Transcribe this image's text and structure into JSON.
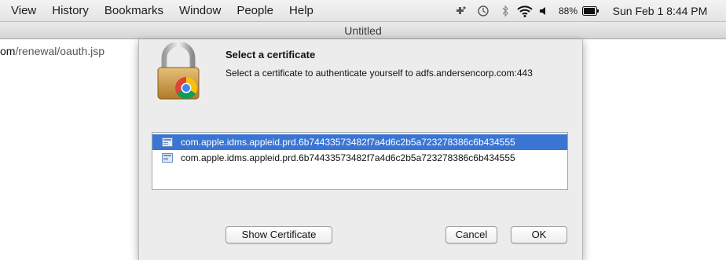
{
  "menubar": {
    "items": [
      "View",
      "History",
      "Bookmarks",
      "Window",
      "People",
      "Help"
    ],
    "battery_percent": "88%",
    "clock": "Sun Feb 1  8:44 PM"
  },
  "window": {
    "title": "Untitled"
  },
  "address": {
    "domain_tail": "om",
    "path": "/renewal/oauth.jsp"
  },
  "dialog": {
    "title": "Select a certificate",
    "description": "Select a certificate to authenticate yourself to adfs.andersencorp.com:443",
    "certificates": [
      {
        "label": "com.apple.idms.appleid.prd.6b74433573482f7a4d6c2b5a723278386c6b434555",
        "selected": true
      },
      {
        "label": "com.apple.idms.appleid.prd.6b74433573482f7a4d6c2b5a723278386c6b434555",
        "selected": false
      }
    ],
    "buttons": {
      "show_certificate": "Show Certificate",
      "cancel": "Cancel",
      "ok": "OK"
    }
  },
  "colors": {
    "selection": "#3b75d3",
    "sheet_bg": "#ececec",
    "menubar_bg": "#ececec"
  },
  "icons": [
    "wifi-icon",
    "volume-icon",
    "bluetooth-icon",
    "time-machine-icon",
    "extension-icon",
    "battery-icon",
    "lock-icon",
    "chrome-icon",
    "certificate-icon"
  ]
}
